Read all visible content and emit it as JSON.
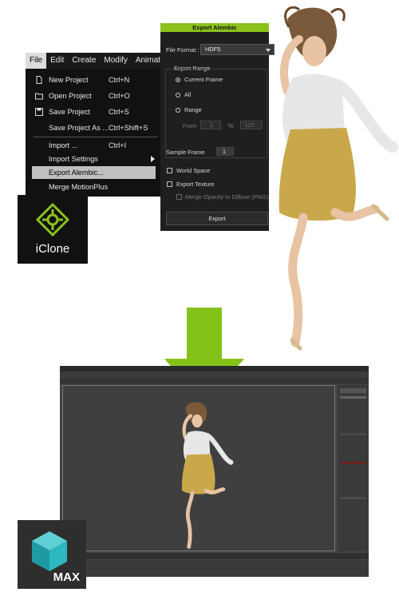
{
  "menubar": {
    "items": [
      "File",
      "Edit",
      "Create",
      "Modify",
      "Animation"
    ]
  },
  "file_menu": {
    "items": [
      {
        "label": "New Project",
        "shortcut": "Ctrl+N",
        "icon": "new-file-icon"
      },
      {
        "label": "Open Project",
        "shortcut": "Ctrl+O",
        "icon": "folder-icon"
      },
      {
        "label": "Save Project",
        "shortcut": "Ctrl+S",
        "icon": "save-icon"
      },
      {
        "label": "Save Project As ...",
        "shortcut": "Ctrl+Shift+S"
      },
      {
        "label": "Import ...",
        "shortcut": "Ctrl+I"
      },
      {
        "label": "Import Settings",
        "shortcut": ""
      },
      {
        "label": "Export Alembic...",
        "shortcut": ""
      },
      {
        "label": "Merge MotionPlus",
        "shortcut": ""
      }
    ]
  },
  "iclone_logo": {
    "text": "iClone"
  },
  "dialog": {
    "title": "Export Alembic",
    "file_format_label": "File Format :",
    "file_format_value": "HDF5",
    "export_range_label": "Export Range",
    "current_frame": "Current Frame",
    "all": "All",
    "range": "Range",
    "from_label": "From",
    "from_value": "1",
    "to_label": "To",
    "to_value": "127",
    "sample_frame_label": "Sample Frame",
    "sample_frame_value": "1",
    "world_space": "World Space",
    "export_texture": "Export Texture",
    "merge_opacity": "Merge Opacity to Diffuse (PNG)",
    "export_button": "Export"
  },
  "max_logo": {
    "text": "MAX"
  },
  "colors": {
    "accent_green": "#8bc21c",
    "dialog_bg": "#1f1f1f"
  }
}
